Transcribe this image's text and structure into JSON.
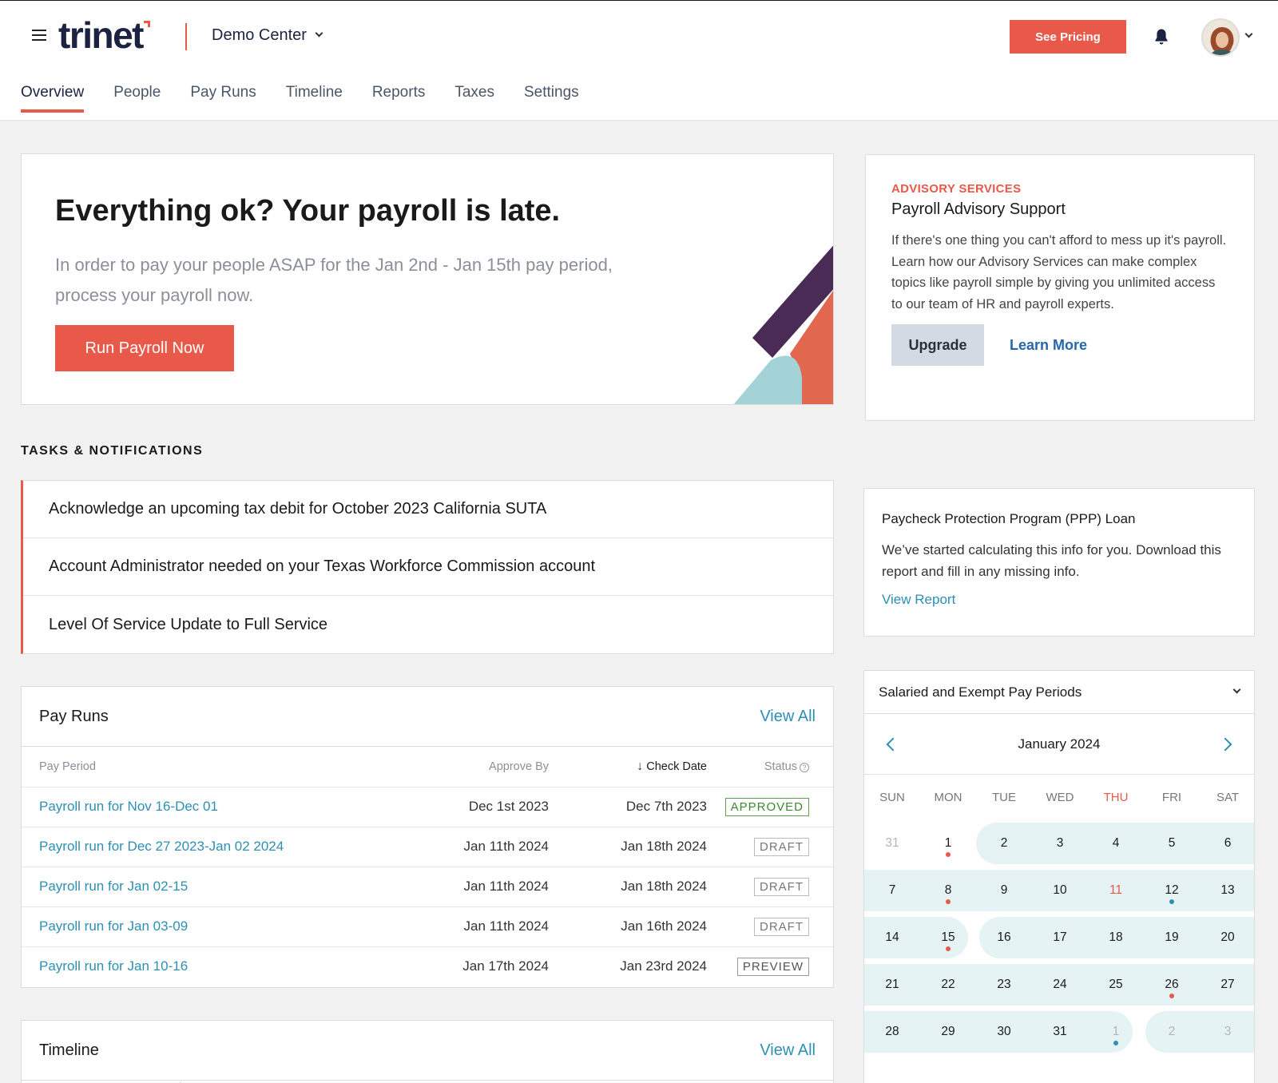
{
  "header": {
    "logo_text": "trinet",
    "workspace": "Demo Center",
    "pricing_label": "See Pricing"
  },
  "tabs": [
    {
      "label": "Overview",
      "active": true
    },
    {
      "label": "People"
    },
    {
      "label": "Pay Runs"
    },
    {
      "label": "Timeline"
    },
    {
      "label": "Reports"
    },
    {
      "label": "Taxes"
    },
    {
      "label": "Settings"
    }
  ],
  "hero": {
    "title": "Everything ok? Your payroll is late.",
    "body": "In order to pay your people ASAP for the Jan 2nd - Jan 15th pay period, process your payroll now.",
    "button": "Run Payroll Now"
  },
  "advisory": {
    "kicker": "ADVISORY SERVICES",
    "title": "Payroll Advisory Support",
    "body": "If there's one thing you can't afford to mess up it's payroll. Learn how our Advisory Services can make complex topics like payroll simple by giving you unlimited access to our team of HR and payroll experts.",
    "upgrade": "Upgrade",
    "learn_more": "Learn More"
  },
  "tasks": {
    "label": "TASKS & NOTIFICATIONS",
    "items": [
      "Acknowledge an upcoming tax debit for October 2023 California SUTA",
      "Account Administrator needed on your Texas Workforce Commission account",
      "Level Of Service Update to Full Service"
    ]
  },
  "ppp": {
    "title": "Paycheck Protection Program (PPP) Loan",
    "body": "We’ve started calculating this info for you. Download this report and fill in any missing info.",
    "link": "View Report"
  },
  "payruns": {
    "title": "Pay Runs",
    "view_all": "View All",
    "columns": [
      "Pay Period",
      "Approve By",
      "Check Date",
      "Status"
    ],
    "rows": [
      {
        "period": "Payroll run for Nov 16-Dec 01",
        "approve_by": "Dec 1st 2023",
        "check_date": "Dec 7th 2023",
        "status": "APPROVED"
      },
      {
        "period": "Payroll run for Dec 27 2023-Jan 02 2024",
        "approve_by": "Jan 11th 2024",
        "check_date": "Jan 18th 2024",
        "status": "DRAFT"
      },
      {
        "period": "Payroll run for Jan 02-15",
        "approve_by": "Jan 11th 2024",
        "check_date": "Jan 18th 2024",
        "status": "DRAFT"
      },
      {
        "period": "Payroll run for Jan 03-09",
        "approve_by": "Jan 11th 2024",
        "check_date": "Jan 16th 2024",
        "status": "DRAFT"
      },
      {
        "period": "Payroll run for Jan 10-16",
        "approve_by": "Jan 17th 2024",
        "check_date": "Jan 23rd 2024",
        "status": "PREVIEW"
      }
    ]
  },
  "timeline": {
    "title": "Timeline",
    "view_all": "View All"
  },
  "calendar": {
    "selector": "Salaried and Exempt Pay Periods",
    "month": "January 2024",
    "weekdays": [
      "SUN",
      "MON",
      "TUE",
      "WED",
      "THU",
      "FRI",
      "SAT"
    ],
    "today_weekday": "THU",
    "weeks": [
      [
        {
          "d": "31",
          "muted": true
        },
        {
          "d": "1",
          "dot": "red"
        },
        {
          "d": "2"
        },
        {
          "d": "3"
        },
        {
          "d": "4"
        },
        {
          "d": "5"
        },
        {
          "d": "6"
        }
      ],
      [
        {
          "d": "7"
        },
        {
          "d": "8",
          "dot": "red"
        },
        {
          "d": "9"
        },
        {
          "d": "10"
        },
        {
          "d": "11",
          "today": true
        },
        {
          "d": "12",
          "dot": "blue"
        },
        {
          "d": "13"
        }
      ],
      [
        {
          "d": "14"
        },
        {
          "d": "15",
          "dot": "red"
        },
        {
          "d": "16"
        },
        {
          "d": "17"
        },
        {
          "d": "18"
        },
        {
          "d": "19"
        },
        {
          "d": "20"
        }
      ],
      [
        {
          "d": "21"
        },
        {
          "d": "22"
        },
        {
          "d": "23"
        },
        {
          "d": "24"
        },
        {
          "d": "25"
        },
        {
          "d": "26",
          "dot": "red"
        },
        {
          "d": "27"
        }
      ],
      [
        {
          "d": "28"
        },
        {
          "d": "29"
        },
        {
          "d": "30"
        },
        {
          "d": "31"
        },
        {
          "d": "1",
          "muted": true,
          "dot": "blue"
        },
        {
          "d": "2",
          "muted": true
        },
        {
          "d": "3",
          "muted": true
        }
      ]
    ]
  },
  "colors": {
    "accent": "#e8594a",
    "link": "#2d8fb5",
    "navy": "#1c2342",
    "period_band": "#e6f3f5"
  }
}
